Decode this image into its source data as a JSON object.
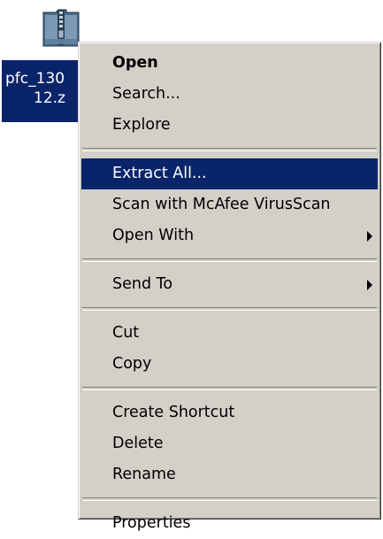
{
  "desktop_icon": {
    "icon": "zip-folder-icon",
    "label_line1": "pfc_130",
    "label_line2": "12.z"
  },
  "context_menu": {
    "groups": [
      [
        "Open",
        "Search...",
        "Explore"
      ],
      [
        "Extract All...",
        "Scan with McAfee VirusScan",
        "Open With"
      ],
      [
        "Send To"
      ],
      [
        "Cut",
        "Copy"
      ],
      [
        "Create Shortcut",
        "Delete",
        "Rename"
      ],
      [
        "Properties"
      ]
    ],
    "default_item": "Open",
    "highlighted_item": "Extract All...",
    "submenu_items": [
      "Open With",
      "Send To"
    ]
  },
  "colors": {
    "highlight": "#0a246a",
    "menu_bg": "#d4d0c8"
  }
}
